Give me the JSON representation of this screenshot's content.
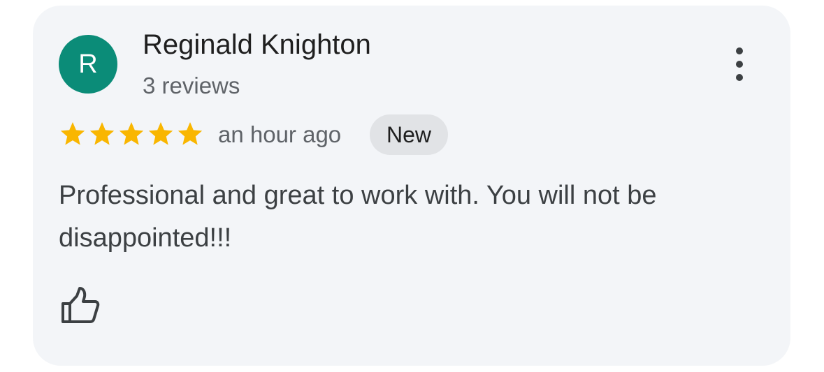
{
  "reviewer": {
    "initial": "R",
    "name": "Reginald Knighton",
    "review_count": "3 reviews",
    "avatar_color": "#0b8c78"
  },
  "rating": {
    "stars": 5,
    "max_stars": 5,
    "star_color": "#f9b600"
  },
  "time_ago": "an hour ago",
  "badge": "New",
  "review_text": "Professional and great to work with. You will not be disappointed!!!",
  "icons": {
    "more": "more-vertical-icon",
    "like": "thumbs-up-icon",
    "star": "star-icon"
  }
}
